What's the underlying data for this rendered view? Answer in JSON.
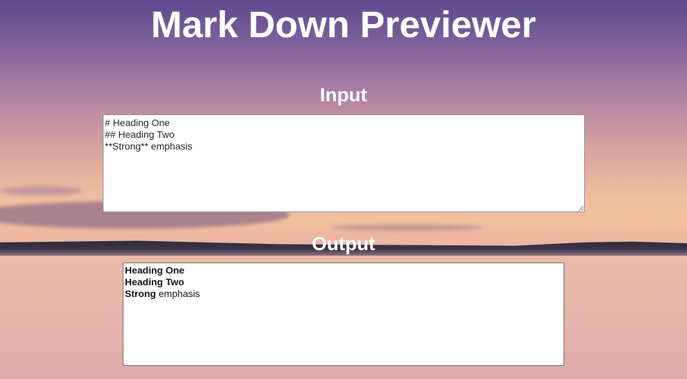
{
  "page": {
    "title": "Mark Down Previewer"
  },
  "input": {
    "label": "Input",
    "value": "# Heading One\n## Heading Two\n**Strong** emphasis"
  },
  "output": {
    "label": "Output",
    "heading_one": "Heading One",
    "heading_two": "Heading Two",
    "strong_text": "Strong",
    "emphasis_text": " emphasis"
  }
}
